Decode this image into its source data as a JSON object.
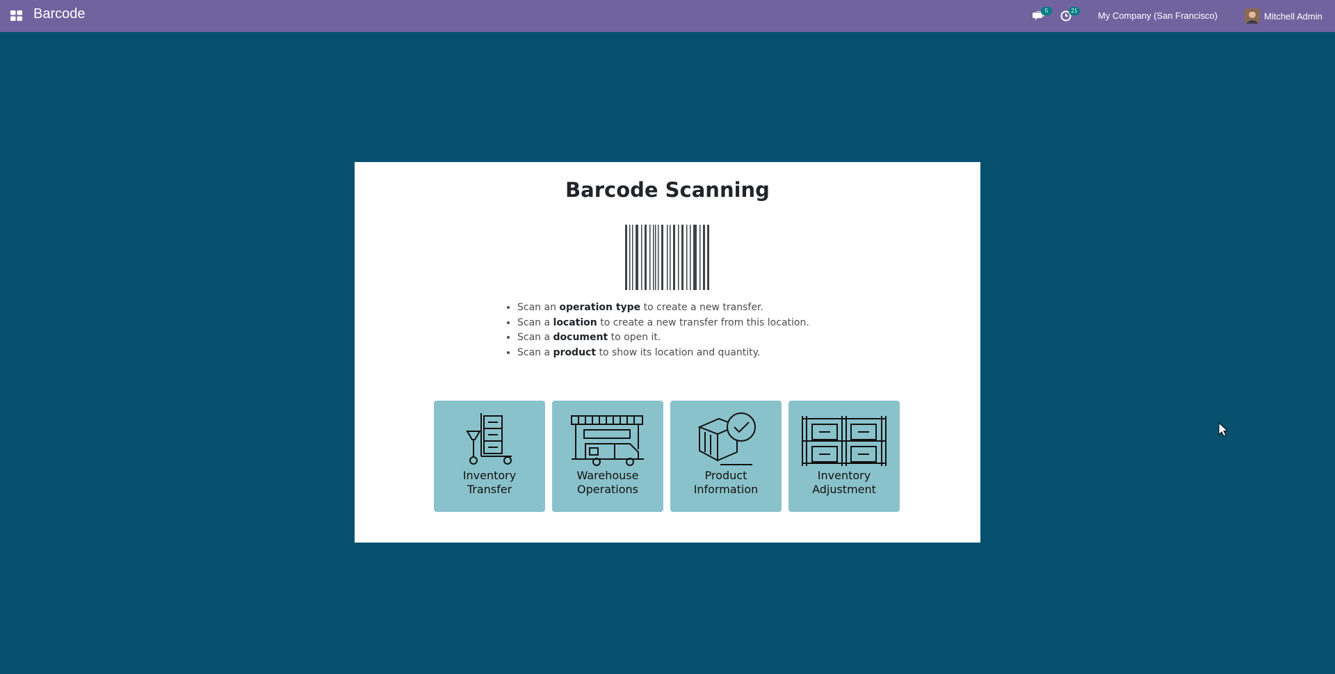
{
  "navbar": {
    "app_name": "Barcode",
    "messages_count": "5",
    "activities_count": "21",
    "company": "My Company (San Francisco)",
    "user_name": "Mitchell Admin",
    "bar_color": "#71639e"
  },
  "main": {
    "title": "Barcode Scanning",
    "instructions": [
      {
        "prefix": "Scan an ",
        "bold": "operation type",
        "suffix": " to create a new transfer."
      },
      {
        "prefix": "Scan a ",
        "bold": "location",
        "suffix": " to create a new transfer from this location."
      },
      {
        "prefix": "Scan a ",
        "bold": "document",
        "suffix": " to open it."
      },
      {
        "prefix": "Scan a ",
        "bold": "product",
        "suffix": " to show its location and quantity."
      }
    ],
    "tiles": [
      {
        "line1": "Inventory",
        "line2": "Transfer",
        "icon": "pallet-truck-icon"
      },
      {
        "line1": "Warehouse",
        "line2": "Operations",
        "icon": "warehouse-icon"
      },
      {
        "line1": "Product",
        "line2": "Information",
        "icon": "product-check-icon"
      },
      {
        "line1": "Inventory",
        "line2": "Adjustment",
        "icon": "shelves-icon"
      }
    ]
  },
  "colors": {
    "background": "#07516f",
    "tile": "#8ac2cb",
    "badge": "#017e84"
  }
}
